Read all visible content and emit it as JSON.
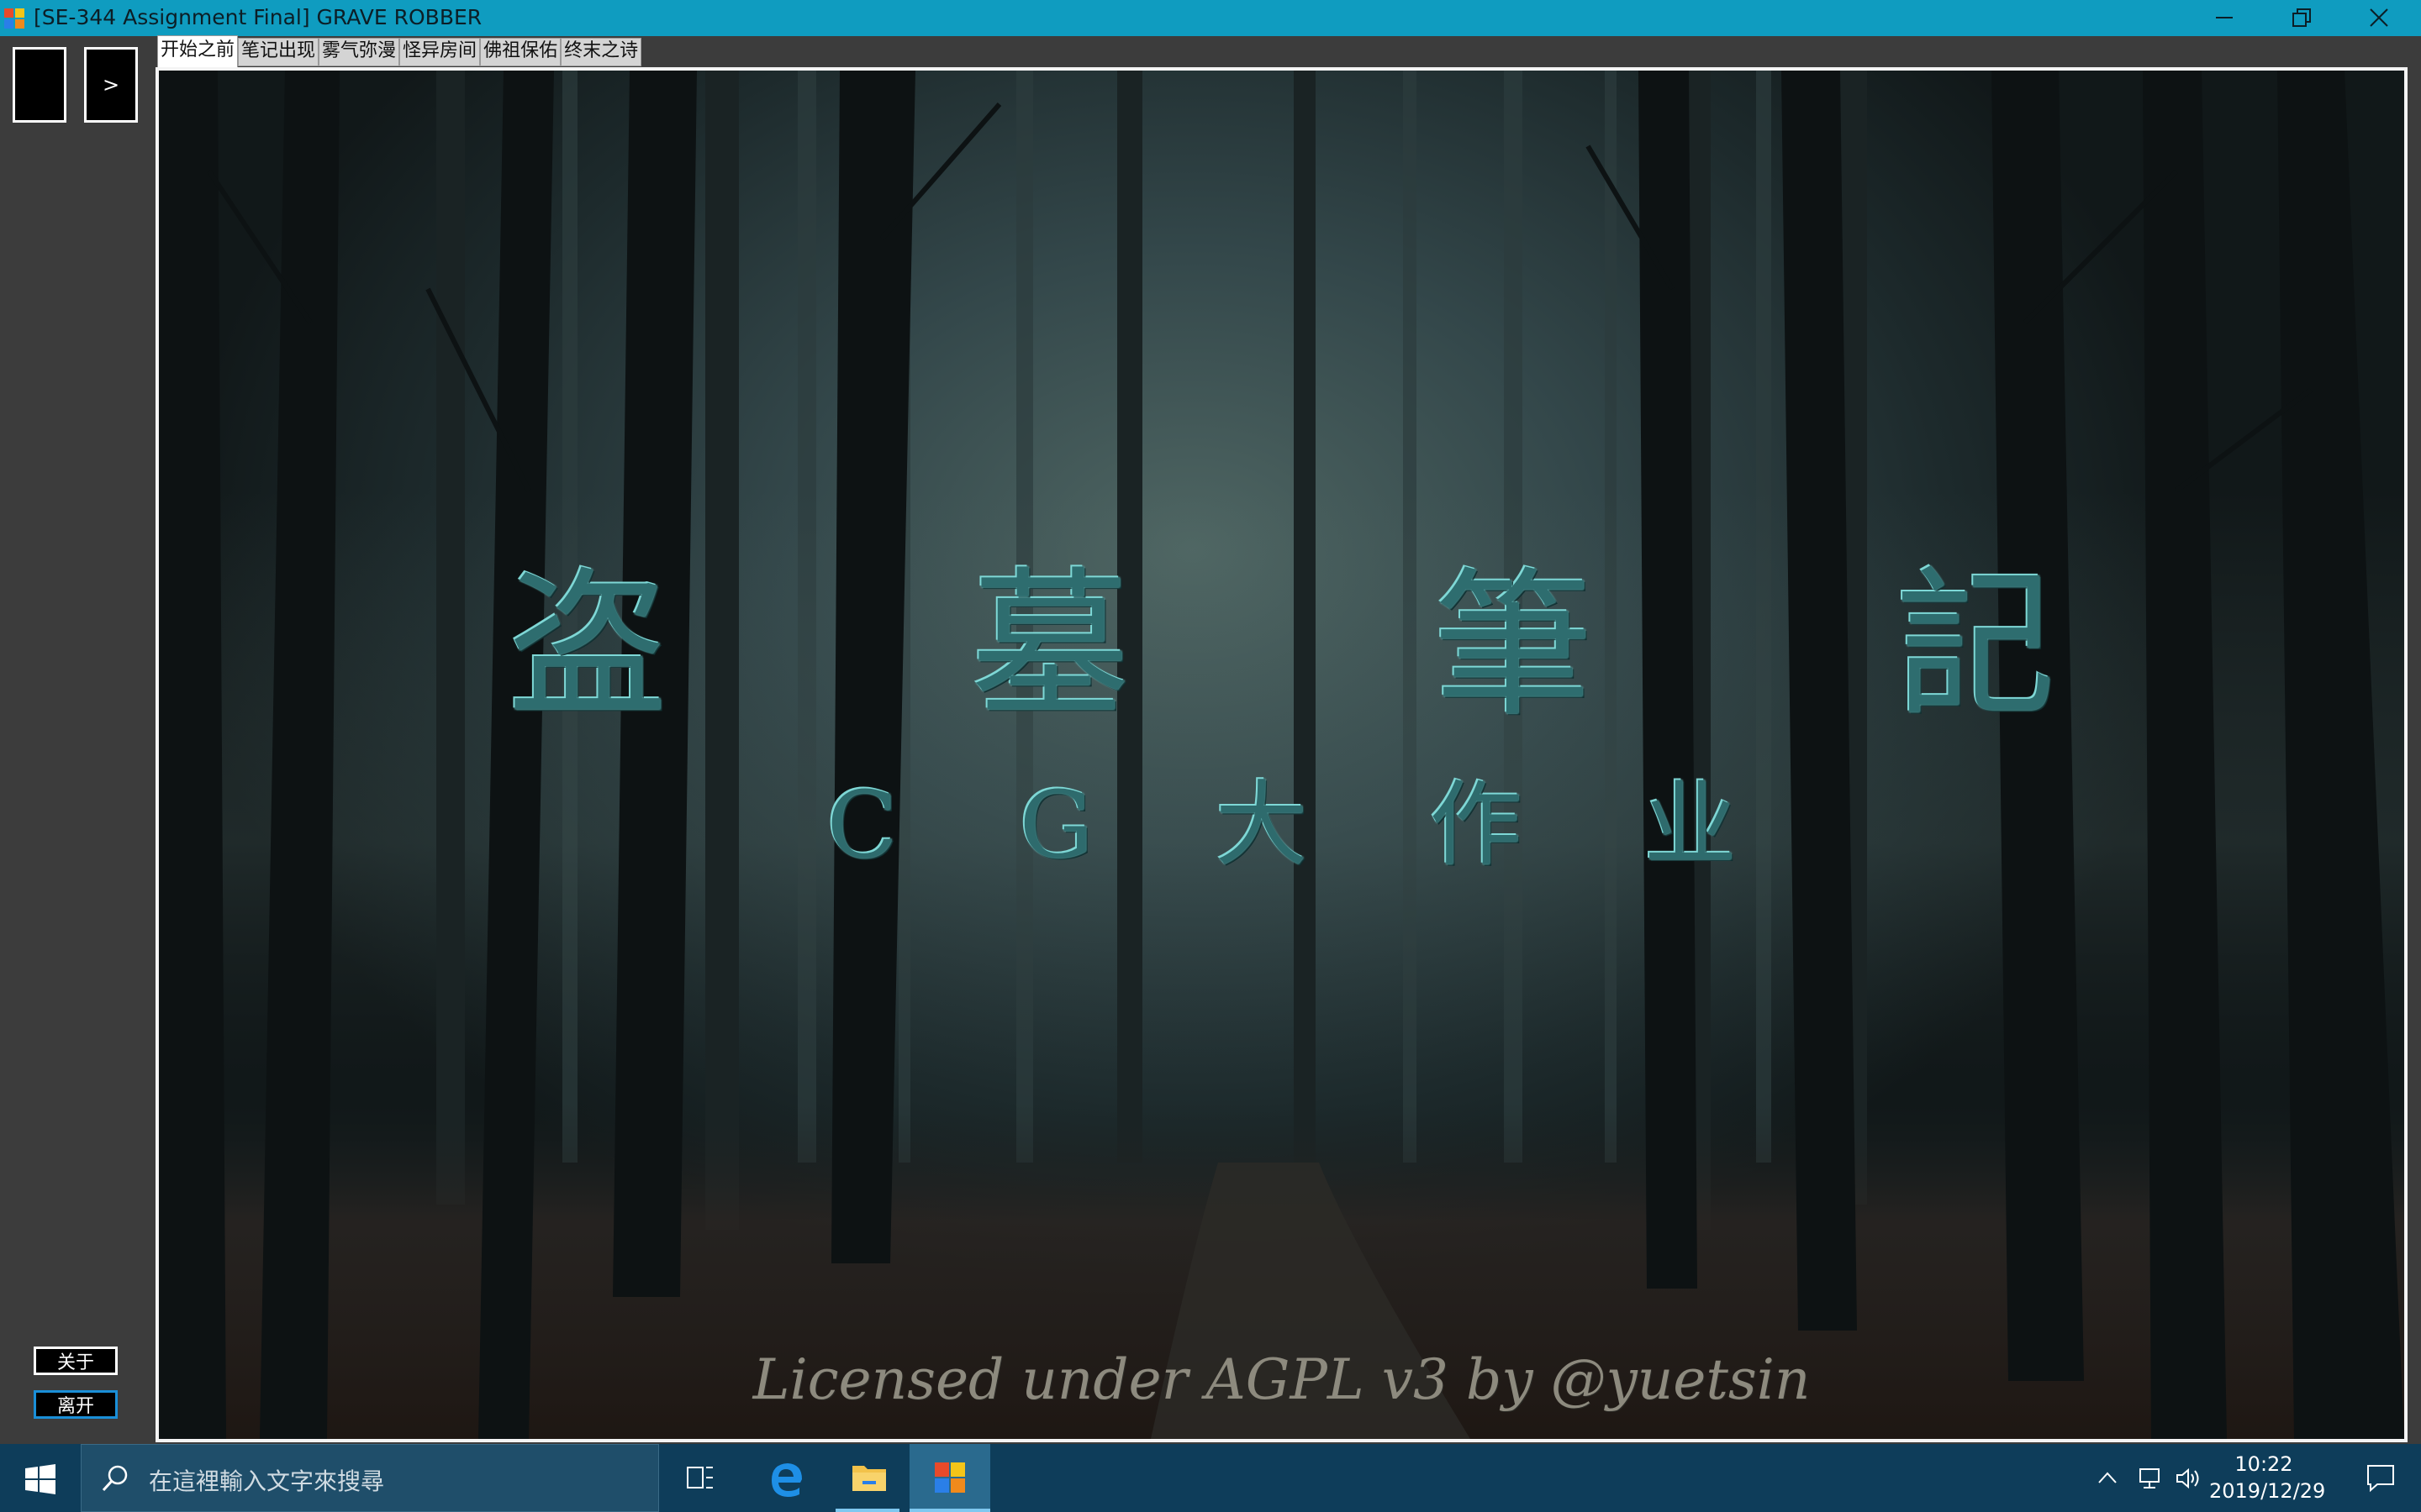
{
  "window": {
    "title": "[SE-344 Assignment Final] GRAVE ROBBER",
    "icons": [
      "app-icon",
      "minimize-icon",
      "restore-icon",
      "close-icon"
    ]
  },
  "sidebar": {
    "next_label": ">",
    "about_label": "关于",
    "quit_label": "离开"
  },
  "tabs": [
    {
      "label": "开始之前",
      "active": true
    },
    {
      "label": "笔记出现",
      "active": false
    },
    {
      "label": "雾气弥漫",
      "active": false
    },
    {
      "label": "怪异房间",
      "active": false
    },
    {
      "label": "佛祖保佑",
      "active": false
    },
    {
      "label": "终末之诗",
      "active": false
    }
  ],
  "scene": {
    "title": "盗 墓 筆 記",
    "subtitle": "C G 大 作 业",
    "license": "Licensed under AGPL v3 by @yuetsin"
  },
  "taskbar": {
    "search_placeholder": "在這裡輸入文字來搜尋",
    "time": "10:22",
    "date": "2019/12/29",
    "pinned": [
      "windows-start-icon",
      "search-icon",
      "task-view-icon",
      "edge-icon",
      "file-explorer-icon",
      "game-app-icon"
    ],
    "tray": [
      "chevron-up-icon",
      "network-icon",
      "volume-icon",
      "notification-icon"
    ]
  }
}
